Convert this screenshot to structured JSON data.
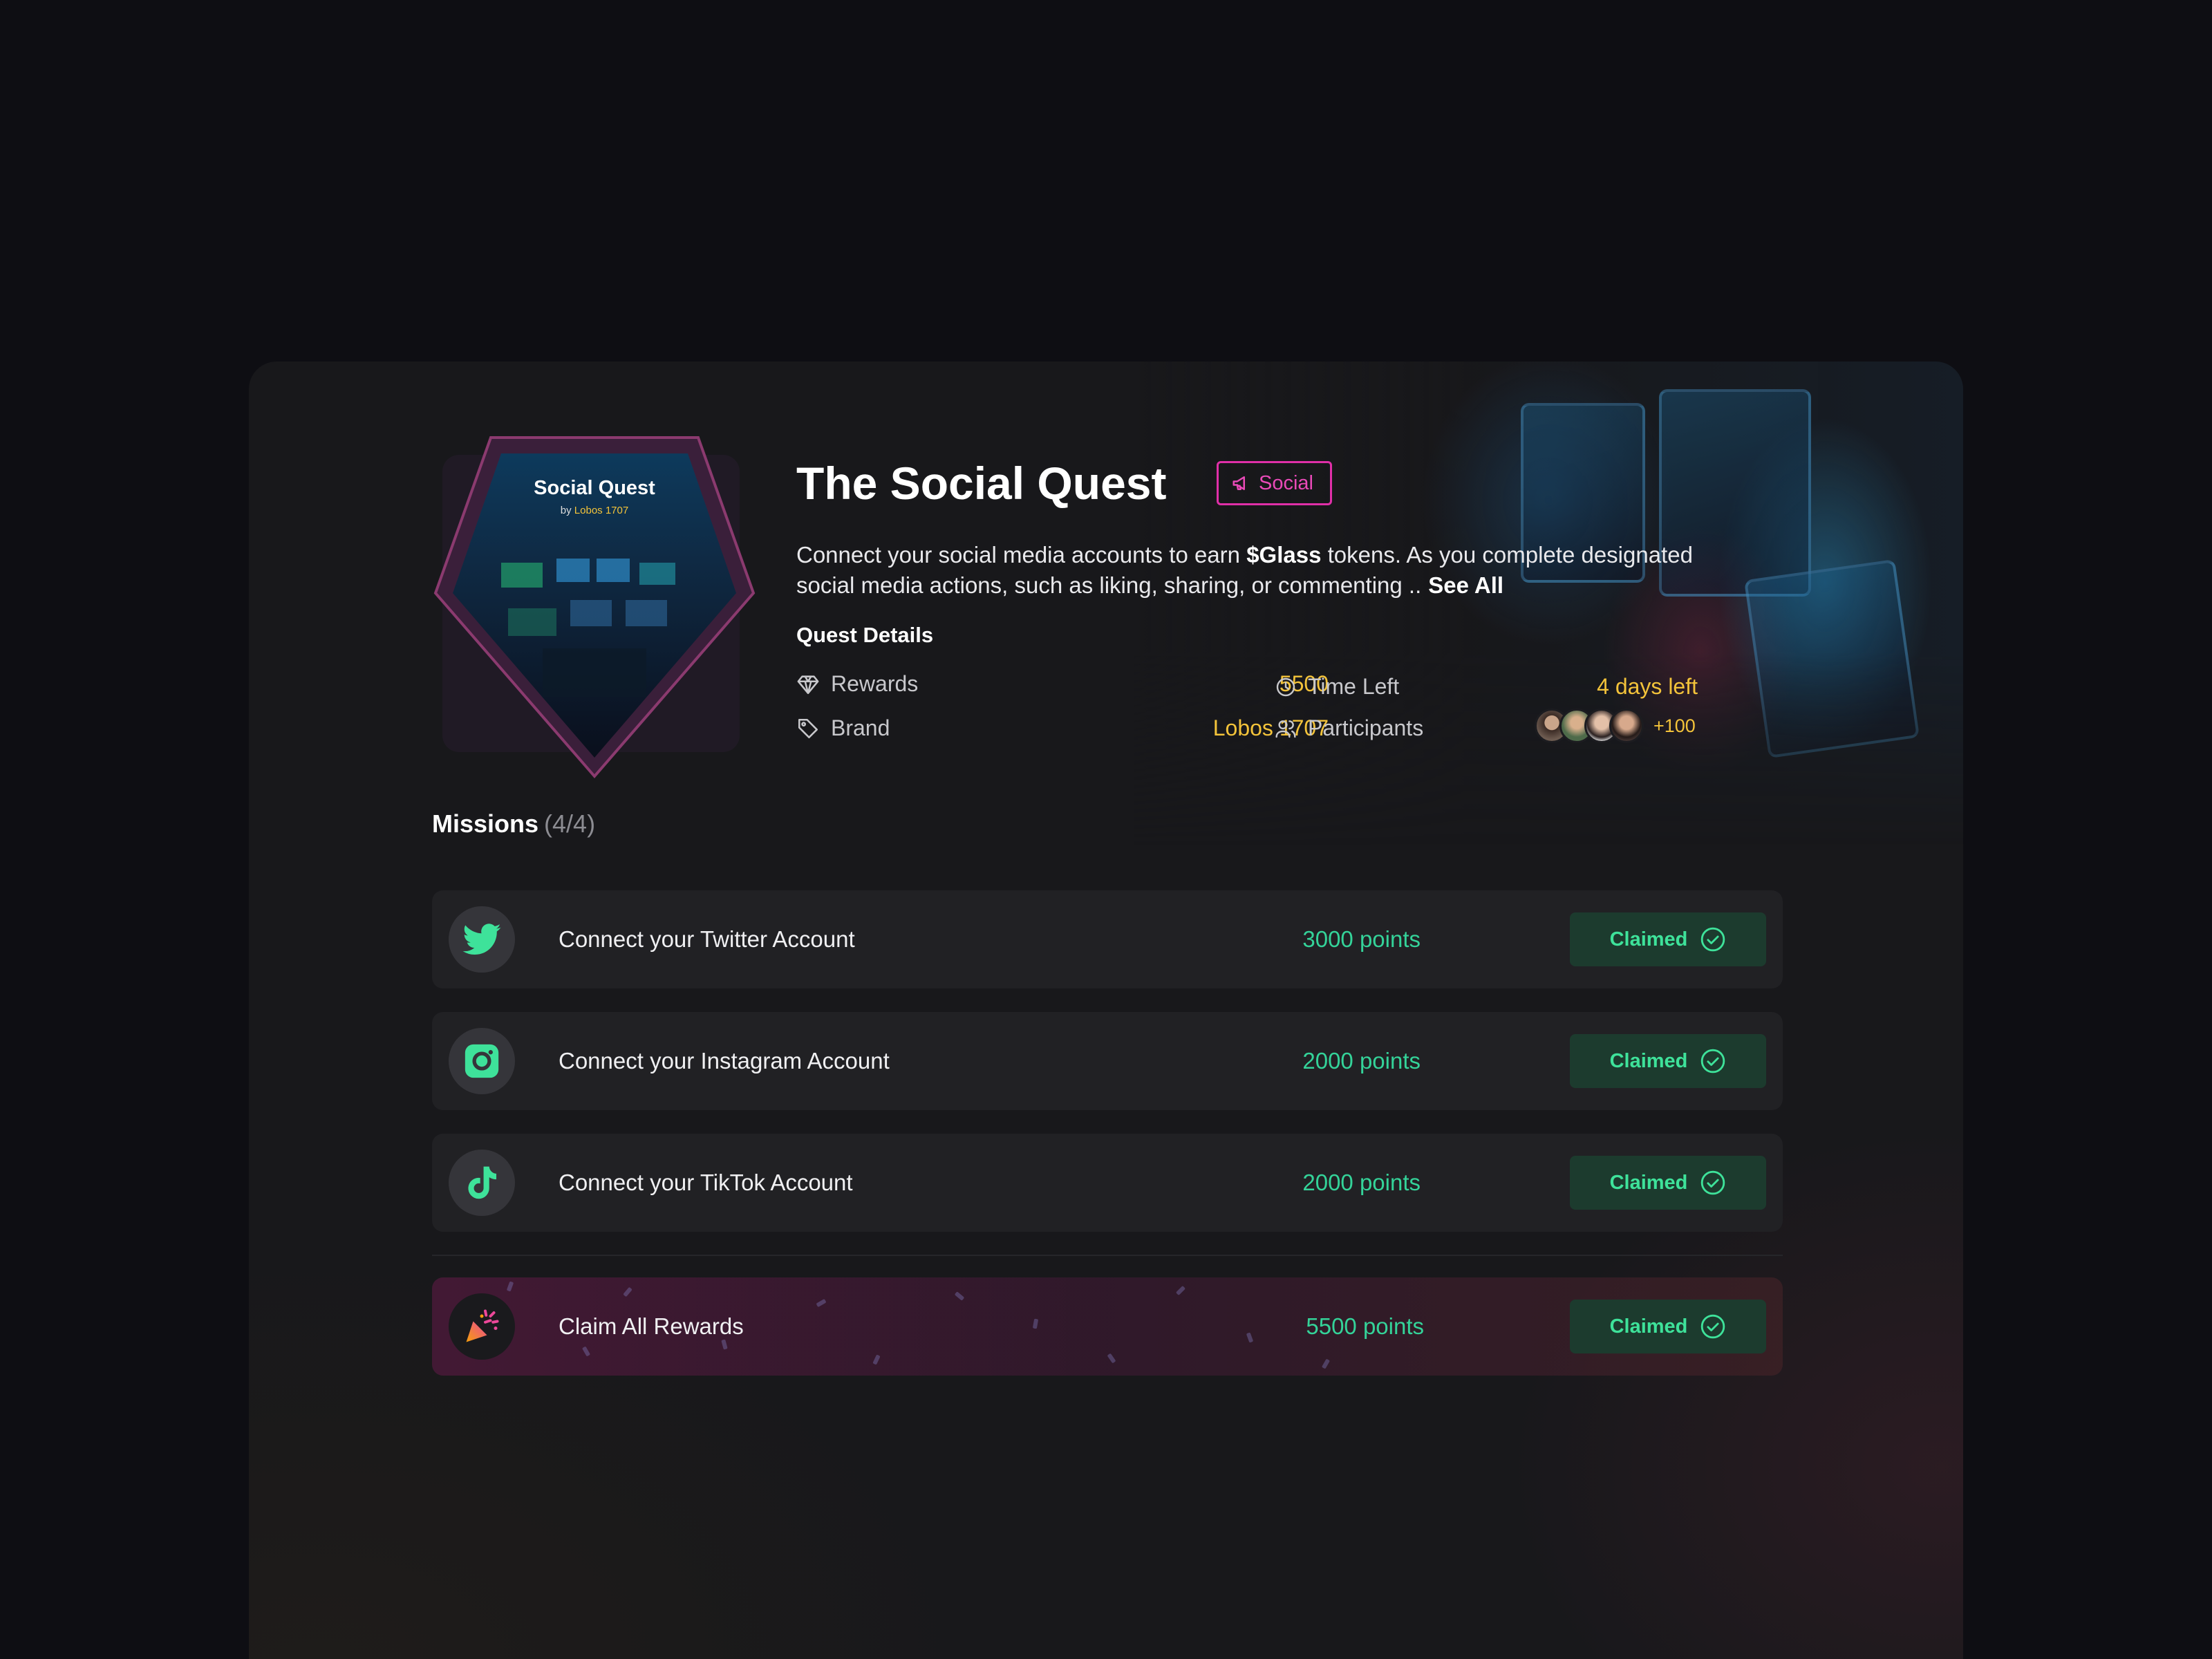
{
  "quest": {
    "badge_title": "Social Quest",
    "badge_by": "by",
    "badge_brand": "Lobos 1707",
    "title": "The Social Quest",
    "tag": "Social",
    "desc_prefix": "Connect your social media accounts to earn ",
    "desc_token": "$Glass",
    "desc_suffix": " tokens. As you complete designated social media actions, such as liking, sharing, or commenting ..",
    "see_all": "See All"
  },
  "details": {
    "heading": "Quest Details",
    "rewards_label": "Rewards",
    "rewards_value": "5500",
    "brand_label": "Brand",
    "brand_value": "Lobos 1707",
    "time_label": "Time Left",
    "time_value": "4 days left",
    "participants_label": "Participants",
    "participants_more": "+100"
  },
  "missions": {
    "heading": "Missions",
    "count": "(4/4)",
    "items": [
      {
        "label": "Connect your Twitter Account",
        "points": "3000 points",
        "status": "Claimed",
        "icon": "twitter-icon"
      },
      {
        "label": "Connect your Instagram Account",
        "points": "2000 points",
        "status": "Claimed",
        "icon": "instagram-icon"
      },
      {
        "label": "Connect your TikTok Account",
        "points": "2000 points",
        "status": "Claimed",
        "icon": "tiktok-icon"
      },
      {
        "label": "Claim All Rewards",
        "points": "5500 points",
        "status": "Claimed",
        "icon": "party-popper-icon"
      }
    ]
  },
  "colors": {
    "accent_green": "#34d399",
    "accent_yellow": "#f3c33a",
    "accent_pink": "#e02fa8",
    "background": "#18181b"
  }
}
